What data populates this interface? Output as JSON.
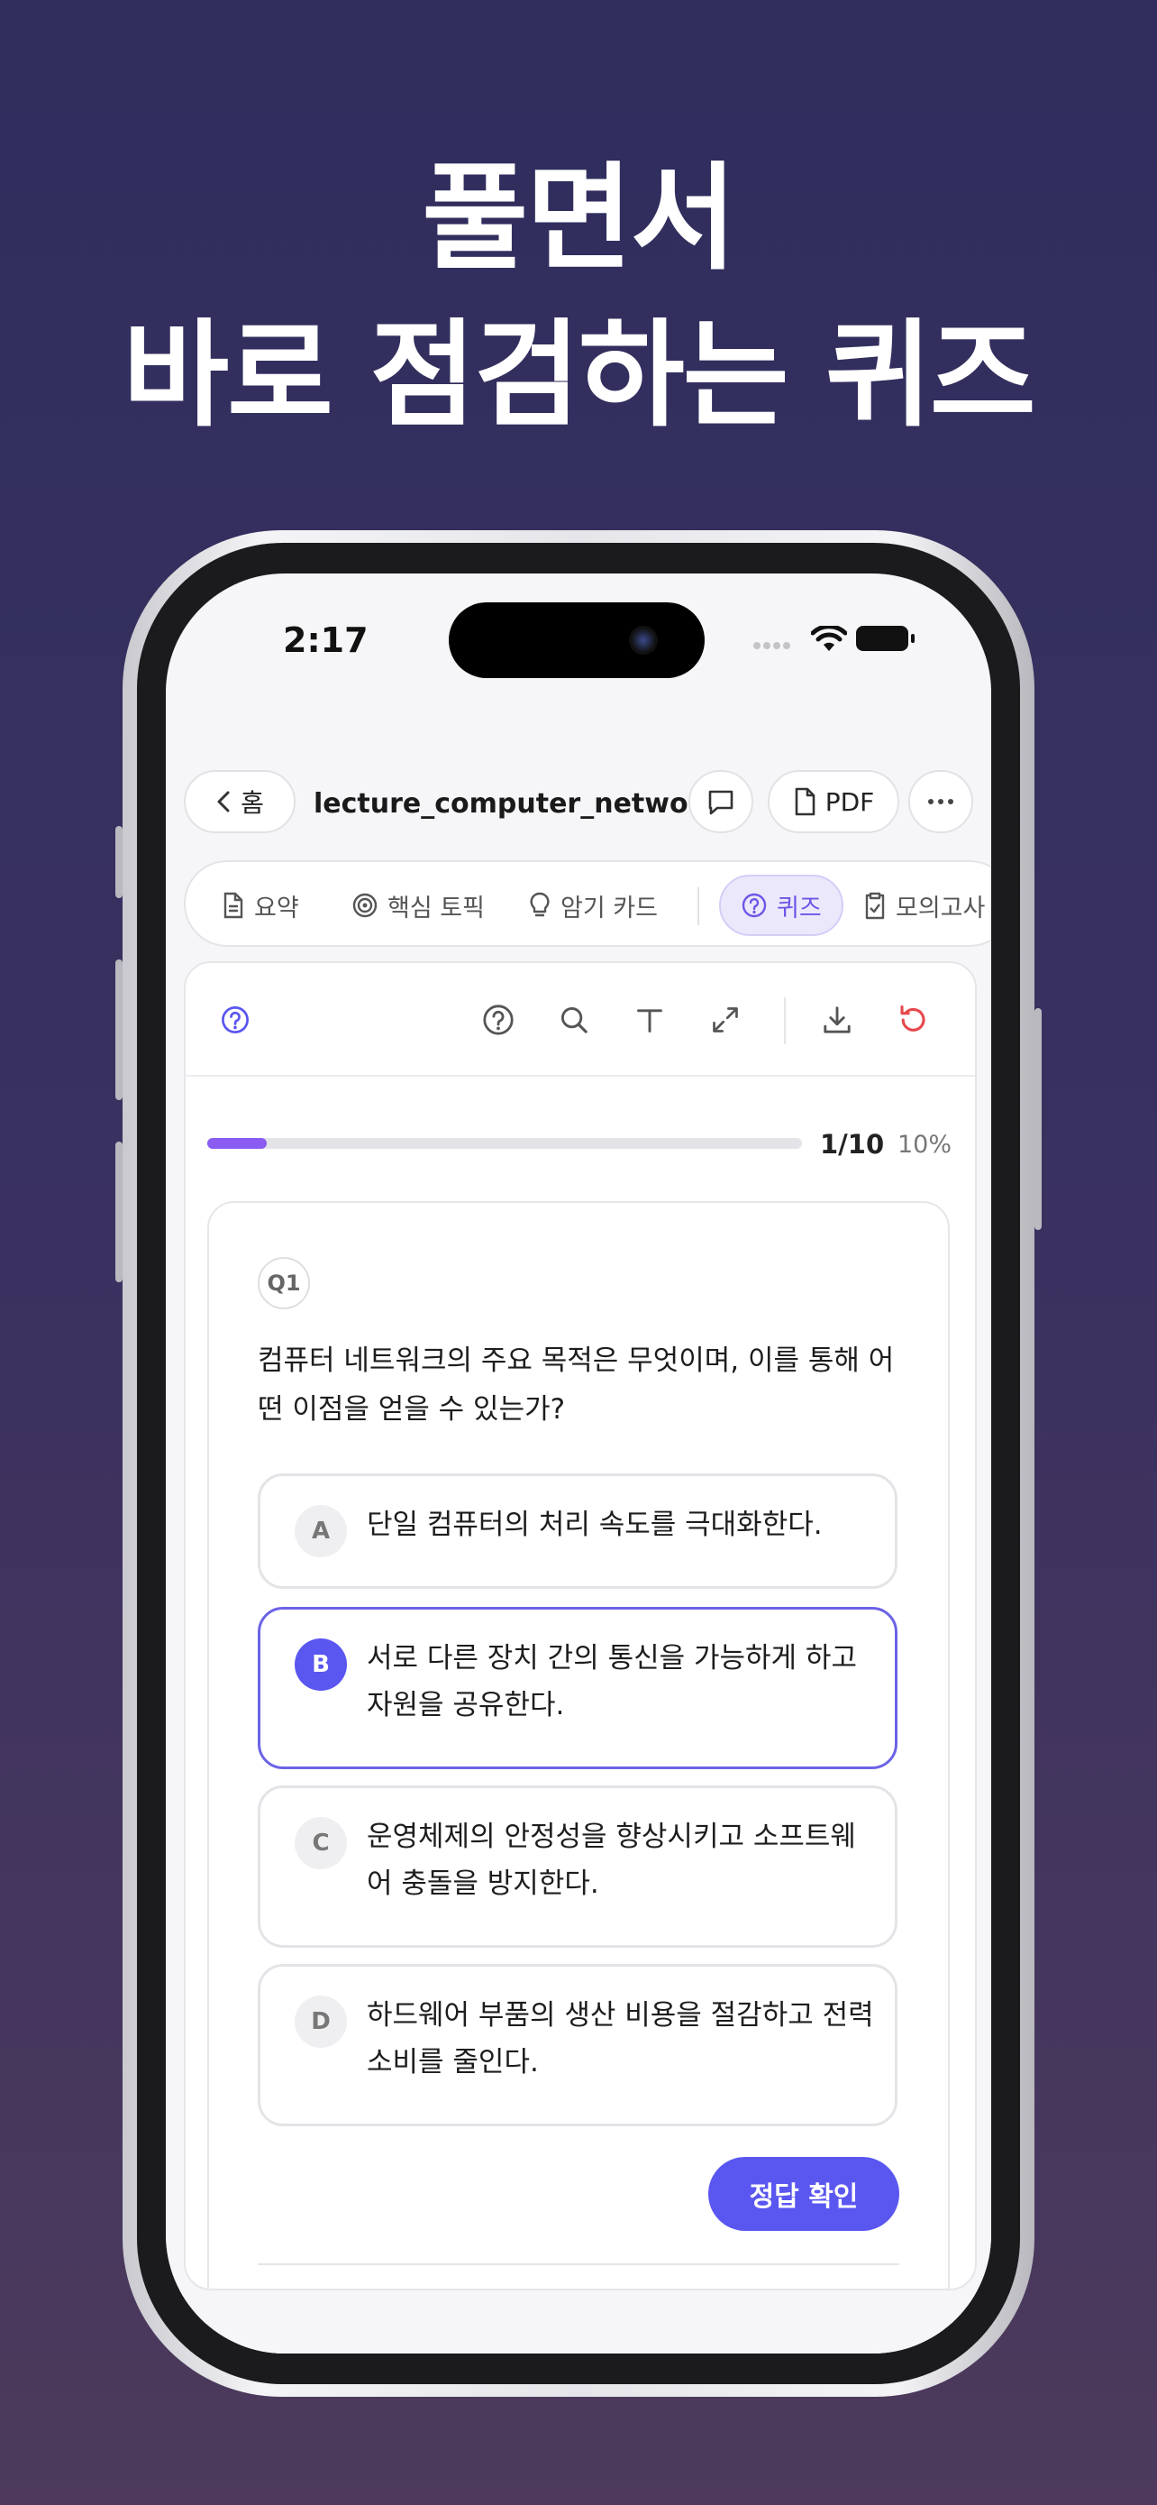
{
  "headline": {
    "line1": "풀면서",
    "line2": "바로 점검하는 퀴즈"
  },
  "status_bar": {
    "time": "2:17"
  },
  "header": {
    "home_label": "홈",
    "doc_title": "lecture_computer_networks",
    "pdf_label": "PDF"
  },
  "tabs": [
    {
      "label": "요약",
      "icon": "document-icon"
    },
    {
      "label": "핵심 토픽",
      "icon": "target-icon"
    },
    {
      "label": "암기 카드",
      "icon": "lightbulb-icon"
    },
    {
      "label": "퀴즈",
      "icon": "question-icon",
      "active": true
    },
    {
      "label": "모의고사",
      "icon": "clipboard-icon"
    }
  ],
  "progress": {
    "count": "1/10",
    "percent": "10%",
    "fraction": 0.1
  },
  "question": {
    "number": "Q1",
    "text": "컴퓨터 네트워크의 주요 목적은 무엇이며, 이를 통해 어떤 이점을 얻을 수 있는가?",
    "options": [
      {
        "letter": "A",
        "text": "단일 컴퓨터의 처리 속도를 극대화한다."
      },
      {
        "letter": "B",
        "text": "서로 다른 장치 간의 통신을 가능하게 하고 자원을 공유한다.",
        "selected": true
      },
      {
        "letter": "C",
        "text": "운영체제의 안정성을 향상시키고 소프트웨어 충돌을 방지한다."
      },
      {
        "letter": "D",
        "text": "하드웨어 부품의 생산 비용을 절감하고 전력 소비를 줄인다."
      }
    ],
    "submit_label": "정답 확인"
  },
  "colors": {
    "accent": "#5a56f0",
    "progress": "#8a5cf2",
    "reset": "#e5484d",
    "background_top": "#2f2e5d"
  }
}
